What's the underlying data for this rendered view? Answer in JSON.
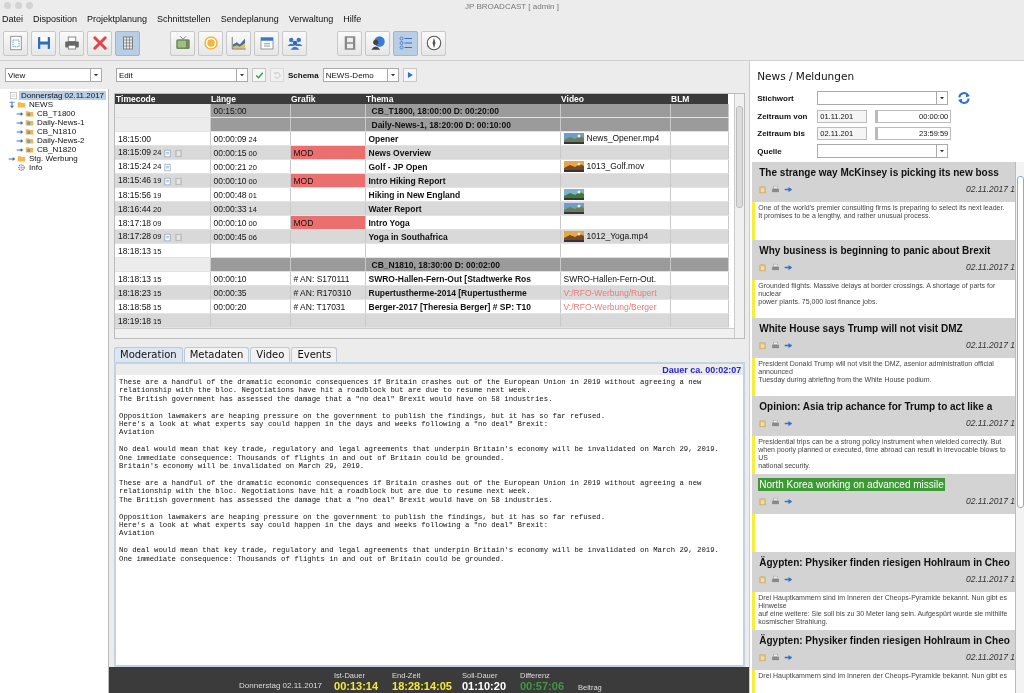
{
  "window": {
    "title": "JP BROADCAST [ admin ]"
  },
  "menu": [
    "Datei",
    "Disposition",
    "Projektplanung",
    "Schnittstellen",
    "Sendeplanung",
    "Verwaltung",
    "Hilfe"
  ],
  "toolbar_groups": [
    {
      "buttons": [
        {
          "kind": "document",
          "selected": false
        },
        {
          "kind": "save",
          "selected": false
        },
        {
          "kind": "print",
          "selected": false
        },
        {
          "kind": "delete",
          "selected": false
        },
        {
          "kind": "grid",
          "selected": true
        }
      ]
    },
    {
      "buttons": [
        {
          "kind": "tv",
          "selected": false
        },
        {
          "kind": "coin",
          "selected": false
        },
        {
          "kind": "chart",
          "selected": false
        },
        {
          "kind": "calendar",
          "selected": false
        },
        {
          "kind": "people",
          "selected": false
        }
      ]
    },
    {
      "buttons": [
        {
          "kind": "film",
          "selected": false
        },
        {
          "kind": "globe",
          "selected": false
        },
        {
          "kind": "list",
          "selected": true
        },
        {
          "kind": "compass",
          "selected": false
        }
      ]
    }
  ],
  "filter_bar": {
    "view": "View",
    "edit": "Edit",
    "schema_label": "Schema",
    "schema": "NEWS-Demo"
  },
  "tree": [
    {
      "label": "Donnerstag 02.11.2017",
      "kind": "day",
      "selected": true,
      "children": [
        {
          "label": "NEWS",
          "kind": "folder",
          "selected": false,
          "expanded": true,
          "children": [
            {
              "label": "CB_T1800",
              "kind": "block",
              "selected": false,
              "expanded": false
            },
            {
              "label": "Daily-News-1",
              "kind": "block",
              "selected": false,
              "expanded": false
            },
            {
              "label": "CB_N1810",
              "kind": "block",
              "selected": false,
              "expanded": false
            },
            {
              "label": "Daily-News-2",
              "kind": "block",
              "selected": false,
              "expanded": false
            },
            {
              "label": "CB_N1820",
              "kind": "block",
              "selected": false,
              "expanded": false
            }
          ]
        },
        {
          "label": "Stg. Werbung",
          "kind": "folder",
          "selected": false,
          "expanded": false
        },
        {
          "label": "Info",
          "kind": "info",
          "selected": false
        }
      ]
    }
  ],
  "table": {
    "columns": [
      "Timecode",
      "Länge",
      "Grafik",
      "Thema",
      "Video",
      "BLM"
    ],
    "rows": [
      {
        "kind": "group",
        "length": "00:15:00",
        "title": "CB_T1800, 18:00:00   D: 00:20:00"
      },
      {
        "kind": "group",
        "title": "Daily-News-1, 18:20:00   D: 00:10:00"
      },
      {
        "kind": "item",
        "timecode": "18:15:00",
        "length": "00:00:09",
        "length_frames": "24",
        "title": "Opener",
        "video": {
          "kind": "picture",
          "file": "News_Opener.mp4",
          "offline": false
        }
      },
      {
        "kind": "item",
        "timecode": "18:15:09",
        "frames": "24",
        "has_script": true,
        "has_media": true,
        "length": "00:00:15",
        "length_frames": "00",
        "grafik": {
          "text": "MOD",
          "kind": "mod"
        },
        "title": "News Overview"
      },
      {
        "kind": "item",
        "timecode": "18:15:24",
        "frames": "24",
        "has_script": true,
        "length": "00:00:21",
        "length_frames": "20",
        "title": "Golf - JP Open",
        "video": {
          "kind": "picture",
          "file": "1013_Golf.mov",
          "offline": false
        }
      },
      {
        "kind": "item",
        "timecode": "18:15:46",
        "frames": "19",
        "has_script": true,
        "has_media": true,
        "length": "00:00:10",
        "length_frames": "00",
        "grafik": {
          "text": "MOD",
          "kind": "mod"
        },
        "title": "Intro Hiking Report"
      },
      {
        "kind": "item",
        "timecode": "18:15:56",
        "frames": "19",
        "length": "00:00:48",
        "length_frames": "01",
        "title": "Hiking in New England"
      },
      {
        "kind": "item",
        "timecode": "18:16:44",
        "frames": "20",
        "length": "00:00:33",
        "length_frames": "14",
        "title": "Water Report"
      },
      {
        "kind": "item",
        "timecode": "18:17:18",
        "frames": "09",
        "length": "00:00:10",
        "length_frames": "00",
        "grafik": {
          "text": "MOD",
          "kind": "mod"
        },
        "title": "Intro Yoga"
      },
      {
        "kind": "item",
        "timecode": "18:17:28",
        "frames": "09",
        "has_script": true,
        "has_media": true,
        "length": "00:00:45",
        "length_frames": "06",
        "title": "Yoga in Southafrica",
        "video": {
          "kind": "picture",
          "file": "1012_Yoga.mp4",
          "offline": false
        }
      },
      {
        "kind": "item",
        "timecode": "18:18:13",
        "frames": "15"
      },
      {
        "kind": "group",
        "title": "CB_N1810, 18:30:00   D: 00:02:00"
      },
      {
        "kind": "item",
        "timecode": "18:18:13",
        "frames": "15",
        "length": "00:00:10",
        "grafik": {
          "text": "# AN: S170111",
          "kind": "plain"
        },
        "title": "SWRO-Hallen-Fern-Out [Stadtwerke Ros",
        "video": {
          "kind": "file",
          "file": "SWRO-Hallen-Fern-Out.",
          "offline": false
        }
      },
      {
        "kind": "item",
        "timecode": "18:18:23",
        "frames": "15",
        "length": "00:00:35",
        "grafik": {
          "text": "# AN: R170310",
          "kind": "plain"
        },
        "title": "Rupertustherme-2014 [Rupertustherme",
        "video": {
          "kind": "file",
          "file": "V:/RFO-Werbung/Rupert",
          "offline": true
        }
      },
      {
        "kind": "item",
        "timecode": "18:18:58",
        "frames": "15",
        "length": "00:00:20",
        "grafik": {
          "text": "# AN: T17031",
          "kind": "plain"
        },
        "title": "Berger-2017 [Theresia Berger] # SP: T10",
        "video": {
          "kind": "file",
          "file": "V:/RFO-Werbung/Berger",
          "offline": true
        }
      },
      {
        "kind": "item",
        "timecode": "18:19:18",
        "frames": "15"
      }
    ]
  },
  "tabs": [
    {
      "label": "Moderation",
      "selected": true
    },
    {
      "label": "Metadaten",
      "selected": false
    },
    {
      "label": "Video",
      "selected": false
    },
    {
      "label": "Events",
      "selected": false
    }
  ],
  "moderation": {
    "duration": "Dauer ca. 00:02:07",
    "text": "These are a handful of the dramatic economic consequences if Britain crashes out of the European Union in 2019 without agreeing a new relationship with the bloc. Negotiations have hit a roadblock but are due to resume next week.\nThe British government has assessed the damage that a \"no deal\" Brexit would have on 58 industries.\n\nOpposition lawmakers are heaping pressure on the government to publish the findings, but it has so far refused.\nHere's a look at what experts say could happen in the days and weeks following a \"no deal\" Brexit:\nAviation\n\nNo deal would mean that key trade, regulatory and legal agreements that underpin Britain's economy will be invalidated on March 29, 2019.\nOne immediate consequence: Thousands of flights in and out of Britain could be grounded.\nBritain's economy will be invalidated on March 29, 2019.\n\nThese are a handful of the dramatic economic consequences if Britain crashes out of the European Union in 2019 without agreeing a new relationship with the bloc. Negotiations have hit a roadblock but are due to resume next week.\nThe British government has assessed the damage that a \"no deal\" Brexit would have on 58 industries.\n\nOpposition lawmakers are heaping pressure on the government to publish the findings, but it has so far refused.\nHere's a look at what experts say could happen in the days and weeks following a \"no deal\" Brexit:\nAviation\n\nNo deal would mean that key trade, regulatory and legal agreements that underpin Britain's economy will be invalidated on March 29, 2019.\nOne immediate consequence: Thousands of flights in and out of Britain could be grounded."
  },
  "status_bar": {
    "date": "Donnerstag 02.11.2017",
    "metrics": [
      {
        "label": "Ist-Dauer",
        "value": "00:13:14",
        "color": "#f2e93a"
      },
      {
        "label": "End-Zeit",
        "value": "18:28:14:05",
        "color": "#f2e93a"
      },
      {
        "label": "Soll-Dauer",
        "value": "01:10:20",
        "color": "#ffffff"
      },
      {
        "label": "Differenz",
        "value": "00:57:06",
        "color": "#3f9a3f"
      },
      {
        "label": "Beitrag"
      }
    ]
  },
  "news_panel": {
    "title": "News / Meldungen",
    "filters": [
      {
        "label": "Stichwort",
        "kind": "dropdown"
      },
      {
        "label": "Zeitraum von",
        "kind": "range",
        "date": "01.11.201",
        "time": "00:00:00"
      },
      {
        "label": "Zeitraum bis",
        "kind": "range",
        "date": "02.11.201",
        "time": "23:59:59"
      },
      {
        "label": "Quelle",
        "kind": "dropdown"
      }
    ],
    "items": [
      {
        "title": "The strange way McKinsey is picking its new boss",
        "highlighted": false,
        "date": "02.11.2017 1",
        "summary": "One of the world's premier consulting firms is preparing to select its next leader.\nIt promises to be a lengthy, and rather unusual process."
      },
      {
        "title": "Why business is beginning to panic about Brexit",
        "highlighted": false,
        "date": "02.11.2017 1",
        "summary": "Grounded flights. Massive delays at border crossings. A shortage of parts for nuclear\npower plants. 75,000 lost finance jobs."
      },
      {
        "title": "White House says Trump will not visit DMZ",
        "highlighted": false,
        "date": "02.11.2017 1",
        "summary": "President Donald Trump will not visit the DMZ, asenior administration official announced\nTuesday during abriefing from the White House podium."
      },
      {
        "title": "Opinion: Asia trip achance for Trump to act like a",
        "highlighted": false,
        "date": "02.11.2017 1",
        "summary": "Presidential trips can be a strong policy instrument when wielded correctly. But when poorly planned or executed, time abroad can result in irrevocable blows to US\nnational security."
      },
      {
        "title": "North Korea working on advanced missile",
        "highlighted": true,
        "date": "02.11.2017 1"
      },
      {
        "title": "Ägypten: Physiker finden riesigen Hohlraum in Cheo",
        "highlighted": false,
        "date": "02.11.2017 1",
        "summary": "Drei Hauptkammern sind im Inneren der Cheops-Pyramide bekannt. Nun gibt es Hinweise\nauf eine weitere: Sie soll bis zu 30 Meter lang sein. Aufgespürt wurde sie mithilfe kosmischer Strahlung."
      },
      {
        "title": "Ägypten: Physiker finden riesigen Hohlraum in Cheo",
        "highlighted": false,
        "date": "02.11.2017 1",
        "summary": "Drei Hauptkammern sind im Inneren der Cheops-Pyramide bekannt. Nun gibt es"
      }
    ]
  }
}
